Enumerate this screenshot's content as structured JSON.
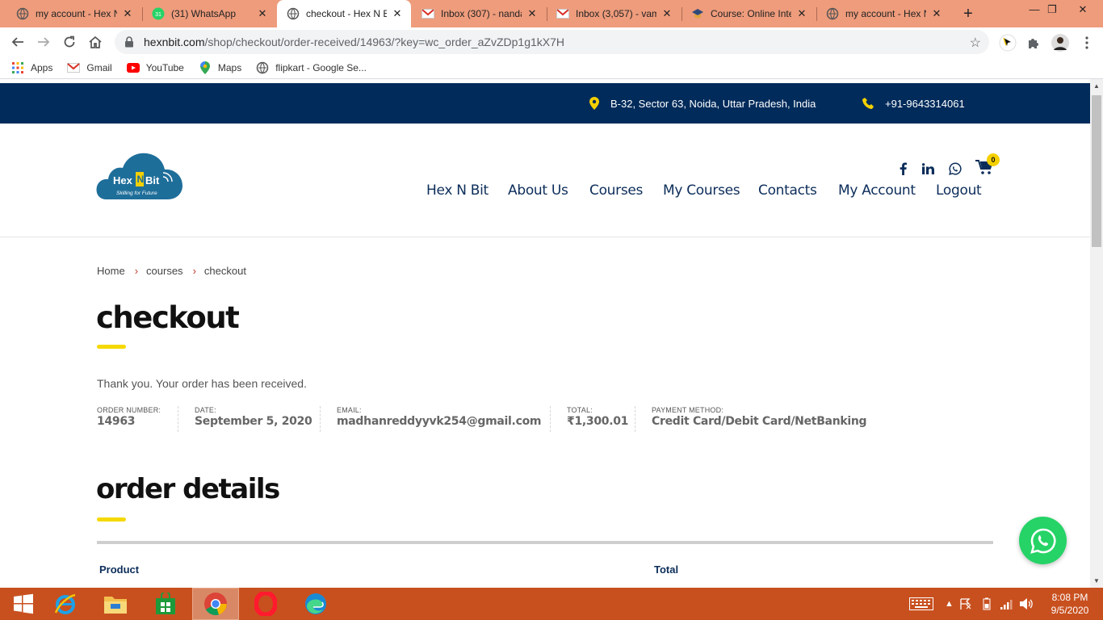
{
  "browser": {
    "tabs": [
      {
        "title": "my account - Hex N",
        "icon": "globe-icon"
      },
      {
        "title": "(31) WhatsApp",
        "icon": "whatsapp-icon",
        "badge": "31"
      },
      {
        "title": "checkout - Hex N Bi",
        "icon": "globe-icon",
        "active": true
      },
      {
        "title": "Inbox (307) - nanda",
        "icon": "gmail-icon"
      },
      {
        "title": "Inbox (3,057) - vam",
        "icon": "gmail-icon"
      },
      {
        "title": "Course: Online Inte",
        "icon": "course-icon"
      },
      {
        "title": "my account - Hex N",
        "icon": "globe-icon"
      }
    ],
    "new_tab": "+",
    "url_host": "hexnbit.com",
    "url_path": "/shop/checkout/order-received/14963/?key=wc_order_aZvZDp1g1kX7H",
    "bookmarks": [
      {
        "label": "Apps",
        "icon": "apps-grid-icon"
      },
      {
        "label": "Gmail",
        "icon": "gmail-icon"
      },
      {
        "label": "YouTube",
        "icon": "youtube-icon"
      },
      {
        "label": "Maps",
        "icon": "maps-pin-icon"
      },
      {
        "label": "flipkart - Google Se...",
        "icon": "globe-icon"
      }
    ]
  },
  "site": {
    "address": "B-32, Sector 63, Noida, Uttar Pradesh, India",
    "phone": "+91-9643314061",
    "logo_text": "Hex N Bit",
    "logo_tagline": "Skilling for Future",
    "cart_count": "0",
    "nav": [
      "Hex N Bit",
      "About Us",
      "Courses",
      "My Courses",
      "Contacts",
      "My Account",
      "Logout"
    ],
    "colors": {
      "navy": "#002b5b",
      "accent": "#f5d800",
      "whatsapp": "#25d366"
    }
  },
  "page": {
    "breadcrumb": [
      "Home",
      "courses",
      "checkout"
    ],
    "title": "checkout",
    "thanks": "Thank you. Your order has been received.",
    "overview": [
      {
        "label": "ORDER NUMBER:",
        "value": "14963"
      },
      {
        "label": "DATE:",
        "value": "September 5, 2020"
      },
      {
        "label": "EMAIL:",
        "value": "madhanreddyyvk254@gmail.com"
      },
      {
        "label": "TOTAL:",
        "value": "₹1,300.01"
      },
      {
        "label": "PAYMENT METHOD:",
        "value": "Credit Card/Debit Card/NetBanking"
      }
    ],
    "details_title": "order details",
    "table_headers": [
      "Product",
      "Total"
    ]
  },
  "taskbar": {
    "clock_time": "8:08 PM",
    "clock_date": "9/5/2020"
  }
}
